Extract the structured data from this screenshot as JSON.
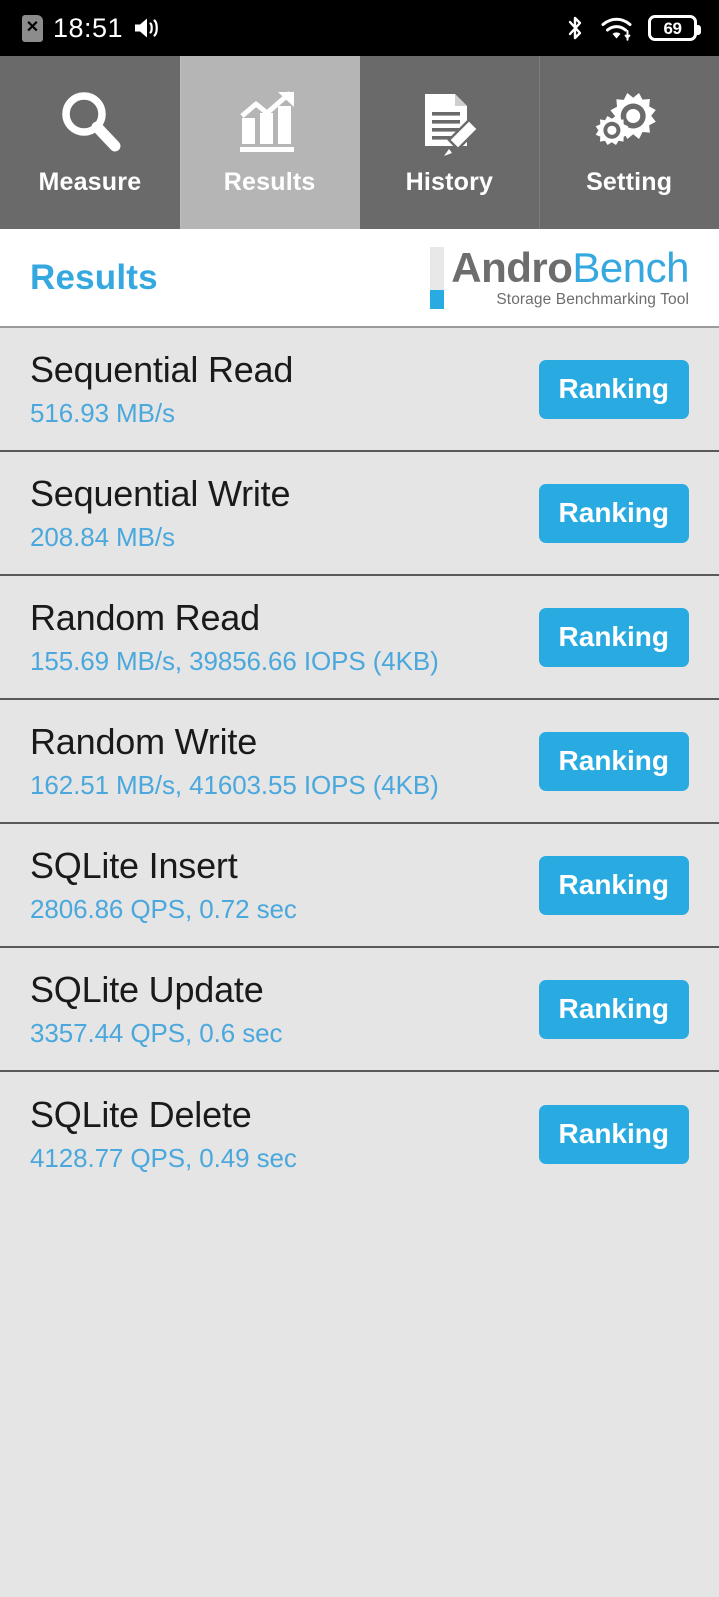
{
  "statusbar": {
    "time": "18:51",
    "sim_icon_glyph": "✕",
    "sim_icon_name": "sim-card-disabled-icon",
    "volume_icon_name": "speaker-icon",
    "bluetooth_icon_name": "bluetooth-icon",
    "wifi_icon_name": "wifi-icon",
    "battery_icon_name": "battery-icon",
    "battery_level": "69"
  },
  "tabs": [
    {
      "label": "Measure",
      "icon": "magnifier-icon",
      "active": false
    },
    {
      "label": "Results",
      "icon": "bar-chart-arrow-icon",
      "active": true
    },
    {
      "label": "History",
      "icon": "document-pencil-icon",
      "active": false
    },
    {
      "label": "Setting",
      "icon": "gears-icon",
      "active": false
    }
  ],
  "header": {
    "title": "Results",
    "logo": {
      "name_part1": "Andro",
      "name_part2": "Bench",
      "tagline": "Storage Benchmarking Tool"
    }
  },
  "results": [
    {
      "title": "Sequential Read",
      "value": "516.93 MB/s",
      "button": "Ranking"
    },
    {
      "title": "Sequential Write",
      "value": "208.84 MB/s",
      "button": "Ranking"
    },
    {
      "title": "Random Read",
      "value": "155.69 MB/s, 39856.66 IOPS (4KB)",
      "button": "Ranking"
    },
    {
      "title": "Random Write",
      "value": "162.51 MB/s, 41603.55 IOPS (4KB)",
      "button": "Ranking"
    },
    {
      "title": "SQLite Insert",
      "value": "2806.86 QPS, 0.72 sec",
      "button": "Ranking"
    },
    {
      "title": "SQLite Update",
      "value": "3357.44 QPS, 0.6 sec",
      "button": "Ranking"
    },
    {
      "title": "SQLite Delete",
      "value": "4128.77 QPS, 0.49 sec",
      "button": "Ranking"
    }
  ],
  "colors": {
    "accent_blue": "#29ABE2",
    "value_blue": "#4aa8dd",
    "title_blue": "#35a8e0",
    "tab_inactive": "#6a6a6a",
    "tab_active": "#b5b5b5",
    "list_background": "#e5e5e5",
    "statusbar_background": "#000000"
  }
}
